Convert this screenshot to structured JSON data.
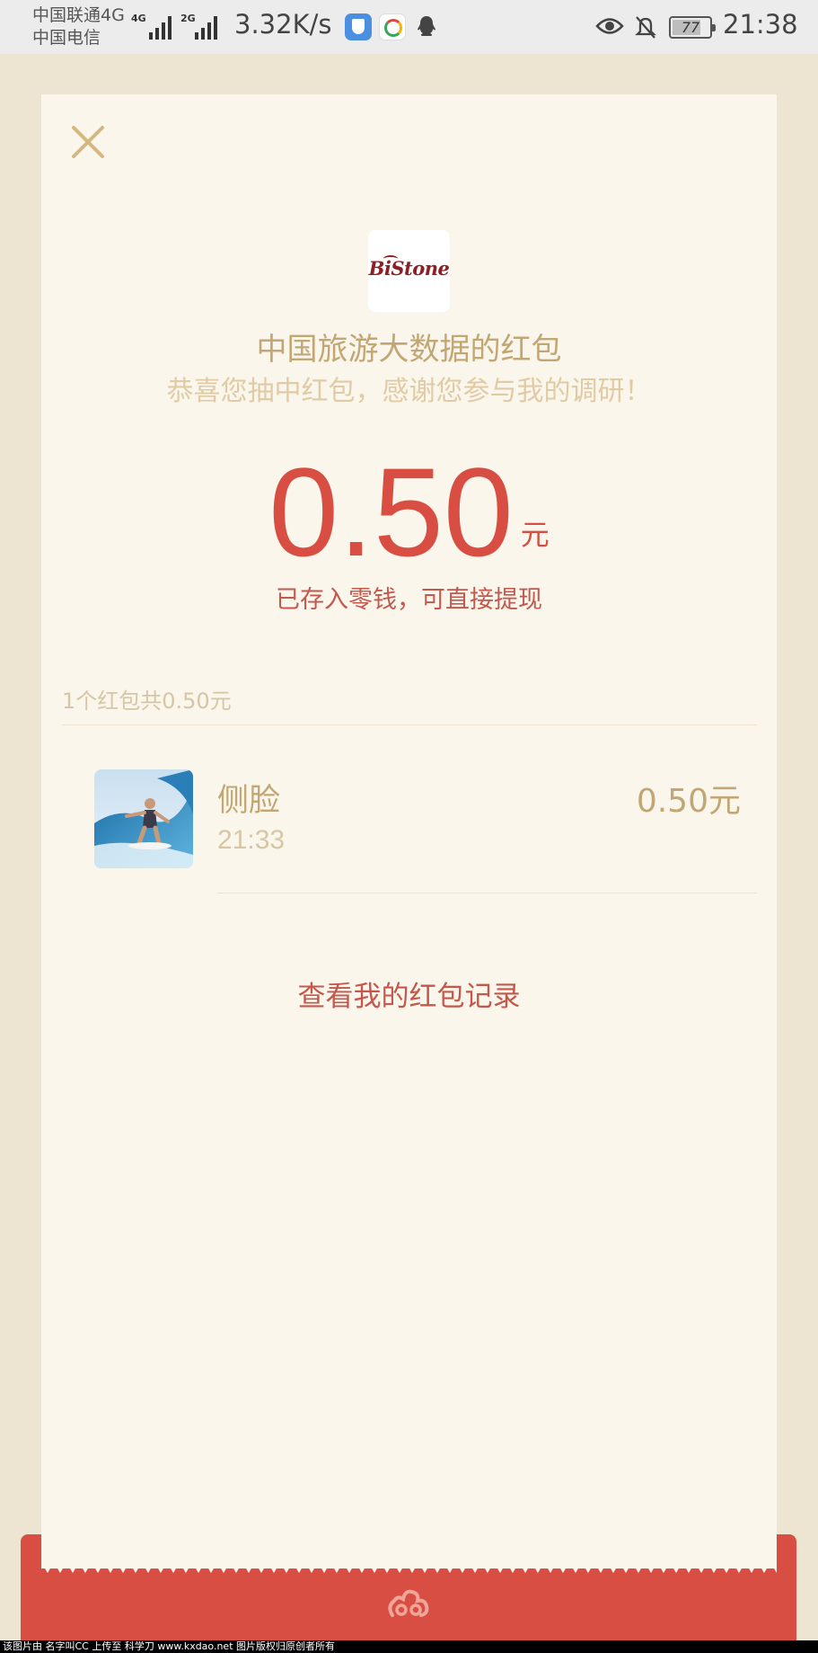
{
  "status_bar": {
    "carrier_1": "中国联通4G",
    "carrier_2": "中国电信",
    "network_1": "4G",
    "network_2": "2G",
    "speed": "3.32K/s",
    "battery": "77",
    "battery_level": 0.77,
    "time": "21:38",
    "icons": [
      "shield-app-icon",
      "ring-app-icon",
      "qq-penguin-icon",
      "eye-icon",
      "bell-off-icon",
      "battery-icon"
    ]
  },
  "red_packet": {
    "brand_logo_text": "BiStone",
    "sender_title": "中国旅游大数据的红包",
    "greeting": "恭喜您抽中红包，感谢您参与我的调研！",
    "amount": "0.50",
    "amount_unit": "元",
    "saved_note": "已存入零钱，可直接提现",
    "summary": "1个红包共0.50元",
    "records": [
      {
        "name": "侧脸",
        "time": "21:33",
        "amount": "0.50元"
      }
    ],
    "history_link": "查看我的红包记录"
  },
  "colors": {
    "accent_red": "#d94e43",
    "gold_text": "#c2a774",
    "card_bg": "#faf6eb",
    "page_bg": "#ede4d2"
  },
  "watermark": "该图片由 名字叫CC 上传至 科学刀 www.kxdao.net 图片版权归原创者所有"
}
